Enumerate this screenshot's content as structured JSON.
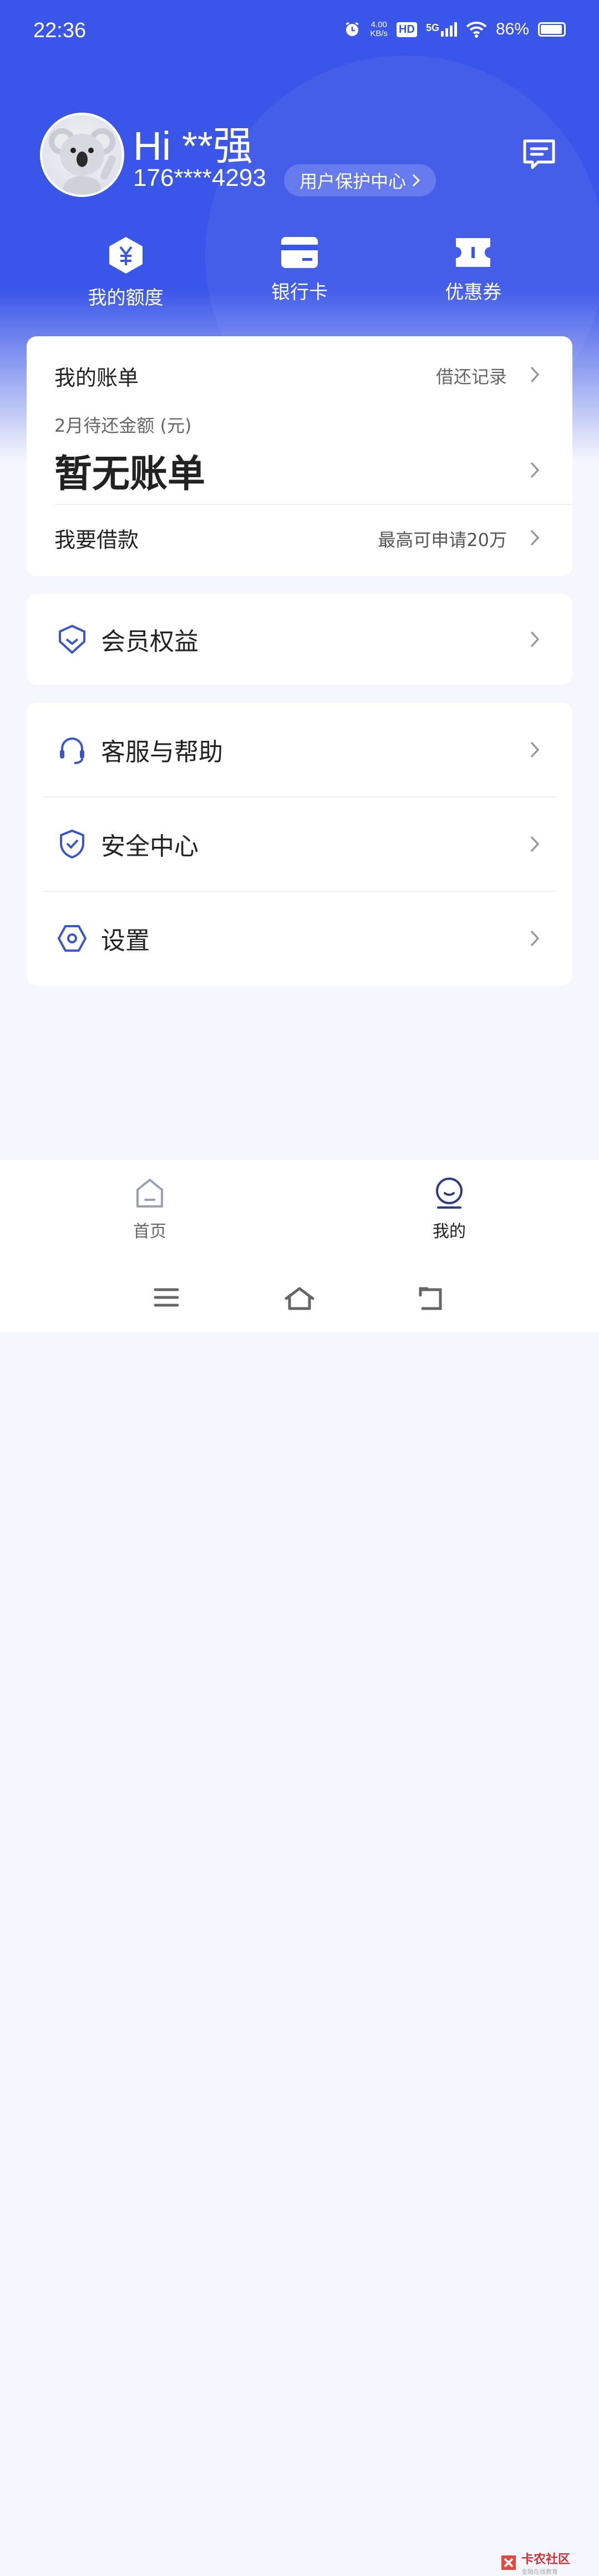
{
  "status": {
    "time": "22:36",
    "net_speed_value": "4.00",
    "net_speed_unit": "KB/s",
    "hd": "HD",
    "signal": "5G",
    "battery": "86%"
  },
  "profile": {
    "greeting": "Hi **强",
    "phone": "176****4293",
    "protect_label": "用户保护中心"
  },
  "quick_actions": [
    {
      "label": "我的额度",
      "icon": "yuan-hexagon-icon"
    },
    {
      "label": "银行卡",
      "icon": "bank-card-icon"
    },
    {
      "label": "优惠券",
      "icon": "coupon-icon"
    }
  ],
  "bill": {
    "title": "我的账单",
    "link": "借还记录",
    "month_label": "2月待还金额 (元)",
    "status": "暂无账单",
    "loan_title": "我要借款",
    "loan_link": "最高可申请20万"
  },
  "membership": {
    "label": "会员权益",
    "icon": "member-shield-icon"
  },
  "menu": [
    {
      "label": "客服与帮助",
      "icon": "headset-icon"
    },
    {
      "label": "安全中心",
      "icon": "security-shield-icon"
    },
    {
      "label": "设置",
      "icon": "settings-hexagon-icon"
    }
  ],
  "tabs": [
    {
      "label": "首页",
      "icon": "home-icon",
      "active": false
    },
    {
      "label": "我的",
      "icon": "profile-icon",
      "active": true
    }
  ],
  "watermark": {
    "title": "卡农社区",
    "subtitle": "金融在线教育"
  },
  "colors": {
    "primary": "#3a56e8",
    "icon_blue": "#3a56c8",
    "tab_inactive": "#9aa0b0"
  }
}
